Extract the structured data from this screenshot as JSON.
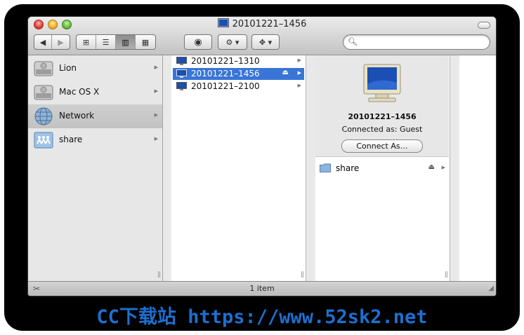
{
  "window": {
    "title": "20101221–1456"
  },
  "toolbar": {
    "back_icon": "◀",
    "forward_icon": "▶",
    "view_icons": [
      "⊞",
      "☰",
      "▥",
      "▦"
    ],
    "quicklook_icon": "◉",
    "action_icon": "⚙ ▾",
    "dropbox_icon": "✥ ▾",
    "search_placeholder": ""
  },
  "sidebar": {
    "items": [
      {
        "label": "Lion",
        "icon": "hard-drive-icon"
      },
      {
        "label": "Mac OS X",
        "icon": "hard-drive-icon"
      },
      {
        "label": "Network",
        "icon": "network-globe-icon"
      },
      {
        "label": "share",
        "icon": "shared-folder-icon"
      }
    ]
  },
  "servers": {
    "items": [
      {
        "label": "20101221–1310"
      },
      {
        "label": "20101221–1456"
      },
      {
        "label": "20101221–2100"
      }
    ]
  },
  "preview": {
    "name": "20101221–1456",
    "connected_as": "Connected as: Guest",
    "connect_button": "Connect As…",
    "share_label": "share"
  },
  "status": {
    "text": "1 item"
  },
  "watermark": "CC下载站 https://www.52sk2.net",
  "colors": {
    "selection": "#3875d7",
    "watermark": "#1d6fd1"
  }
}
